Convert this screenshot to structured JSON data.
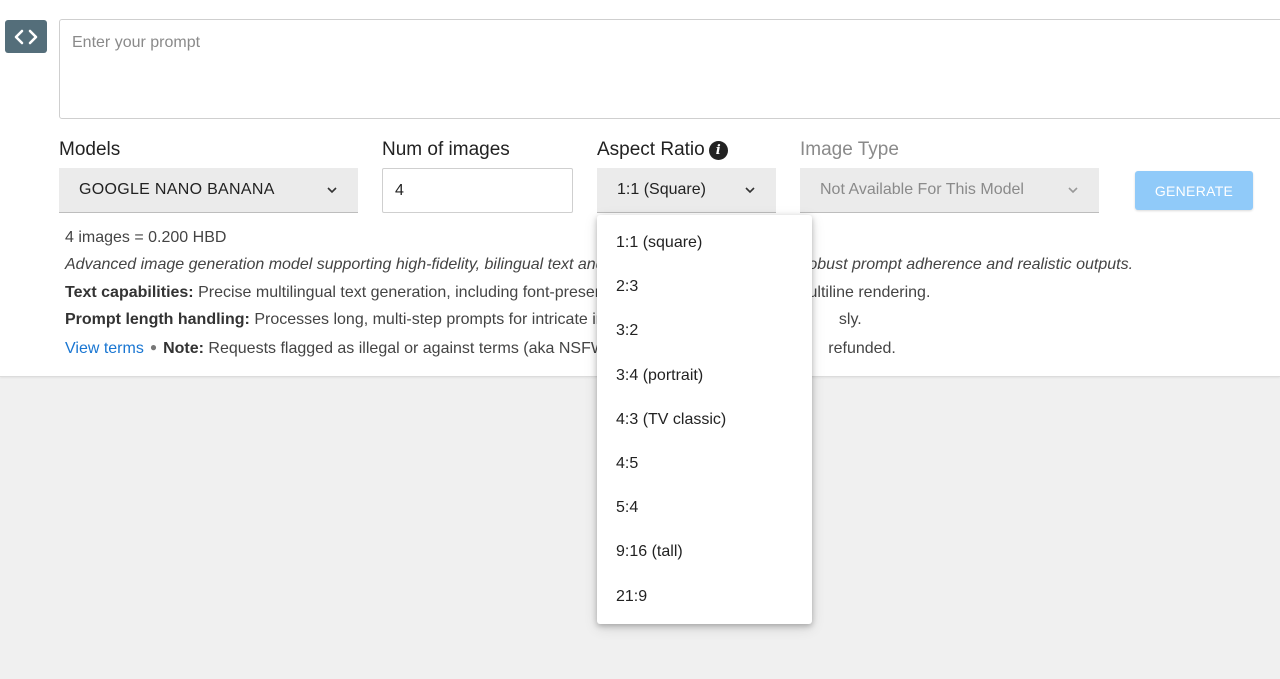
{
  "prompt": {
    "placeholder": "Enter your prompt"
  },
  "models": {
    "label": "Models",
    "selected": "GOOGLE NANO BANANA"
  },
  "num_images": {
    "label": "Num of images",
    "value": "4"
  },
  "aspect_ratio": {
    "label": "Aspect Ratio",
    "selected": "1:1 (Square)",
    "options": [
      "1:1 (square)",
      "2:3",
      "3:2",
      "3:4 (portrait)",
      "4:3 (TV classic)",
      "4:5",
      "5:4",
      "9:16 (tall)",
      "21:9"
    ]
  },
  "image_type": {
    "label": "Image Type",
    "selected": "Not Available For This Model"
  },
  "generate_label": "GENERATE",
  "info": {
    "cost": "4 images = 0.200 HBD",
    "description_left": "Advanced image generation model supporting high-fidelity, bilingual text and ",
    "description_right": "robust prompt adherence and realistic outputs.",
    "text_cap_label": "Text capabilities:",
    "text_cap_left": " Precise multilingual text generation, including font-preservin",
    "text_cap_right": "ultiline rendering.",
    "prompt_len_label": "Prompt length handling:",
    "prompt_len_left": " Processes long, multi-step prompts for intricate imag",
    "prompt_len_right": "sly.",
    "view_terms": "View terms",
    "note_label": "Note:",
    "note_left": " Requests flagged as illegal or against terms (aka NSFW)",
    "note_right": "refunded."
  },
  "colors": {
    "accent": "#1976d2",
    "generate_bg": "#90caf9",
    "toggle_bg": "#546e7a"
  },
  "icons": {
    "code_toggle": "code-brackets-icon",
    "info": "info-icon",
    "chevron": "chevron-down-icon"
  }
}
